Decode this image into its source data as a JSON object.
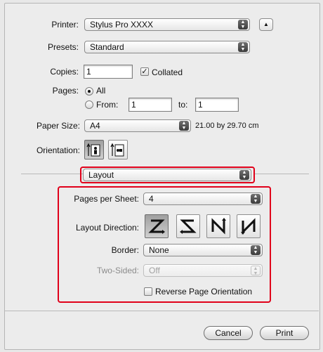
{
  "printer": {
    "label": "Printer:",
    "value": "Stylus Pro XXXX"
  },
  "presets": {
    "label": "Presets:",
    "value": "Standard"
  },
  "copies": {
    "label": "Copies:",
    "value": "1",
    "collated_label": "Collated",
    "collated": true
  },
  "pages": {
    "label": "Pages:",
    "all_label": "All",
    "from_label": "From:",
    "from_value": "1",
    "to_label": "to:",
    "to_value": "1"
  },
  "paper_size": {
    "label": "Paper Size:",
    "value": "A4",
    "dimensions": "21.00 by 29.70 cm"
  },
  "orientation": {
    "label": "Orientation:"
  },
  "panel": {
    "value": "Layout"
  },
  "layout": {
    "pages_per_sheet_label": "Pages per Sheet:",
    "pages_per_sheet_value": "4",
    "direction_label": "Layout Direction:",
    "border_label": "Border:",
    "border_value": "None",
    "two_sided_label": "Two-Sided:",
    "two_sided_value": "Off",
    "reverse_label": "Reverse Page Orientation"
  },
  "buttons": {
    "cancel": "Cancel",
    "print": "Print"
  },
  "colors": {
    "highlight": "#e0001a"
  }
}
